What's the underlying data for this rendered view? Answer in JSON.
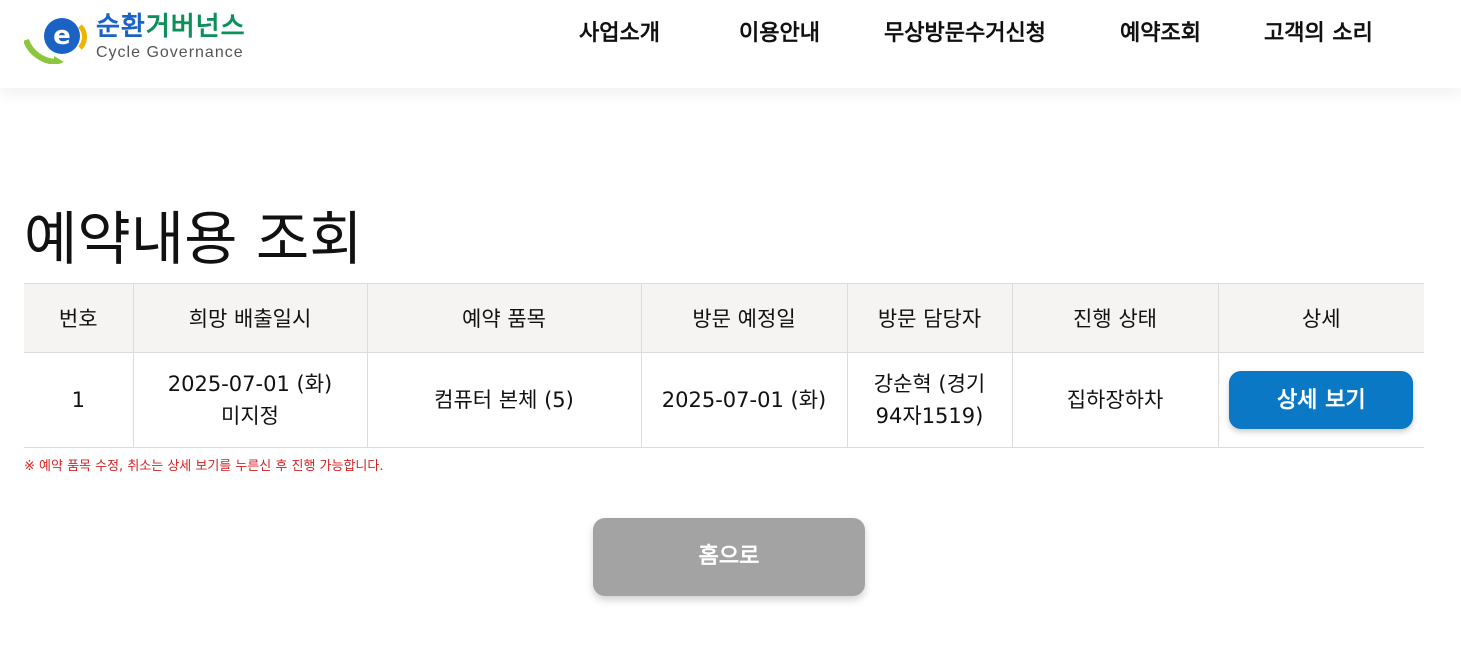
{
  "header": {
    "logo": {
      "title_prefix": "순환",
      "title_rest": "거버넌스",
      "subtitle": "Cycle Governance"
    },
    "nav": [
      {
        "label": "사업소개"
      },
      {
        "label": "이용안내"
      },
      {
        "label": "무상방문수거신청"
      },
      {
        "label": "예약조회"
      },
      {
        "label": "고객의 소리"
      }
    ]
  },
  "page": {
    "title": "예약내용 조회"
  },
  "table": {
    "headers": [
      "번호",
      "희망 배출일시",
      "예약 품목",
      "방문 예정일",
      "방문 담당자",
      "진행 상태",
      "상세"
    ],
    "rows": [
      {
        "no": "1",
        "desired_date": "2025-07-01 (화)",
        "desired_time": "미지정",
        "item": "컴퓨터 본체 (5)",
        "visit_date": "2025-07-01 (화)",
        "staff_line1": "강순혁 (경기",
        "staff_line2": "94자1519)",
        "status": "집하장하차",
        "detail_label": "상세 보기"
      }
    ]
  },
  "notice": "※ 예약 품목 수정, 취소는 상세 보기를 누른신 후 진행 가능합니다.",
  "home_button": "홈으로",
  "colors": {
    "brand_green": "#0b8f5b",
    "brand_blue": "#1a63c4",
    "status_blue": "#1f5fb0",
    "primary_button": "#0a78c5",
    "notice_red": "#d32222",
    "home_button": "#a3a3a3"
  }
}
